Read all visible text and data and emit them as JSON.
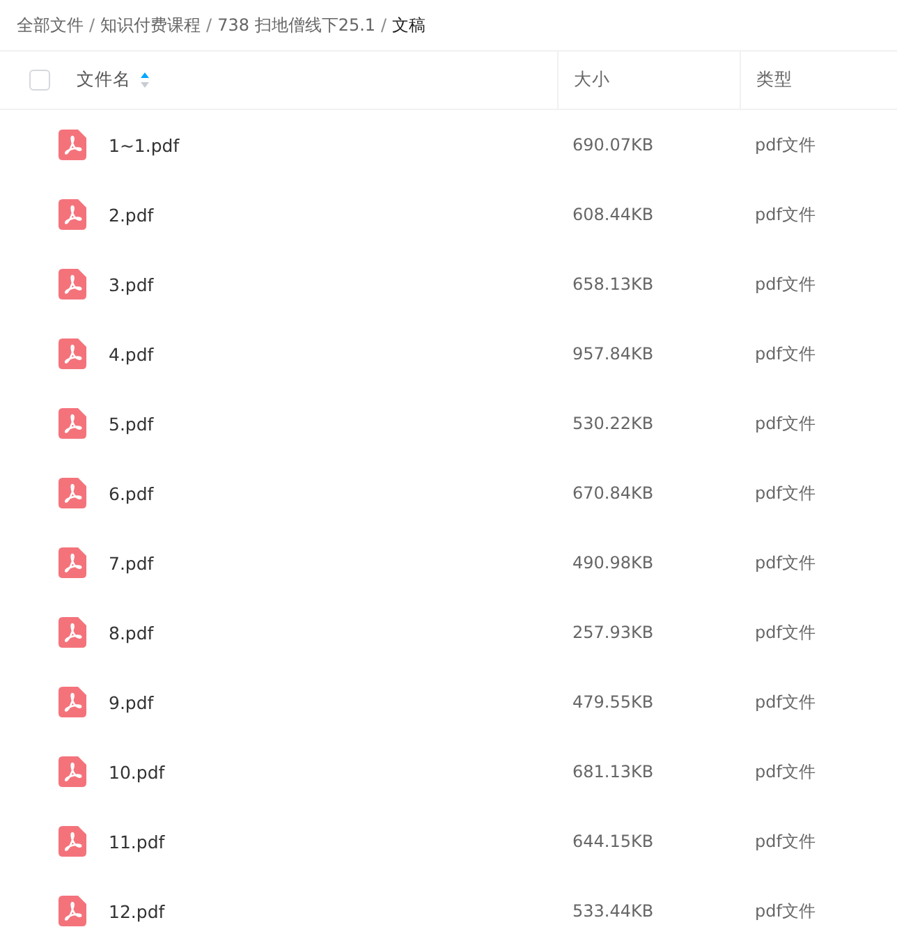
{
  "breadcrumb": {
    "items": [
      {
        "label": "全部文件",
        "current": false
      },
      {
        "label": "知识付费课程",
        "current": false
      },
      {
        "label": "738 扫地僧线下25.1",
        "current": false
      },
      {
        "label": "文稿",
        "current": true
      }
    ],
    "separators": [
      "/",
      "/",
      "/"
    ]
  },
  "table": {
    "select_all": {
      "checked": false
    },
    "sort_ascending": true,
    "columns": [
      {
        "label": "文件名",
        "sorted": true
      },
      {
        "label": "大小",
        "sorted": false
      },
      {
        "label": "类型",
        "sorted": false
      }
    ],
    "rows": [
      {
        "name": "1~1.pdf",
        "size": "690.07KB",
        "type": "pdf文件"
      },
      {
        "name": "2.pdf",
        "size": "608.44KB",
        "type": "pdf文件"
      },
      {
        "name": "3.pdf",
        "size": "658.13KB",
        "type": "pdf文件"
      },
      {
        "name": "4.pdf",
        "size": "957.84KB",
        "type": "pdf文件"
      },
      {
        "name": "5.pdf",
        "size": "530.22KB",
        "type": "pdf文件"
      },
      {
        "name": "6.pdf",
        "size": "670.84KB",
        "type": "pdf文件"
      },
      {
        "name": "7.pdf",
        "size": "490.98KB",
        "type": "pdf文件"
      },
      {
        "name": "8.pdf",
        "size": "257.93KB",
        "type": "pdf文件"
      },
      {
        "name": "9.pdf",
        "size": "479.55KB",
        "type": "pdf文件"
      },
      {
        "name": "10.pdf",
        "size": "681.13KB",
        "type": "pdf文件"
      },
      {
        "name": "11.pdf",
        "size": "644.15KB",
        "type": "pdf文件"
      },
      {
        "name": "12.pdf",
        "size": "533.44KB",
        "type": "pdf文件"
      }
    ]
  }
}
